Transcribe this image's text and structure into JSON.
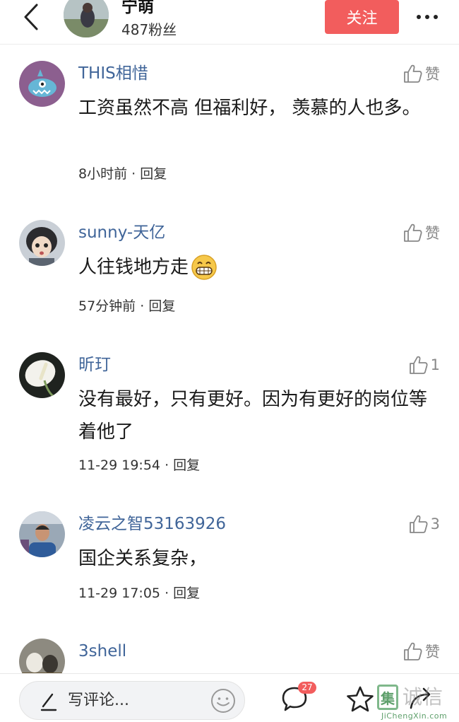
{
  "header": {
    "author_name": "宁萌",
    "fans": "487粉丝",
    "follow_label": "关注"
  },
  "comments": [
    {
      "name": "THIS相惜",
      "like": "赞",
      "text": "工资虽然不高 但福利好， 羡慕的人也多。",
      "time": "8小时前",
      "reply": "回复",
      "avatar": "blue-monster-avatar"
    },
    {
      "name": "sunny-天亿",
      "like": "赞",
      "text": "人往钱地方走",
      "emoji": "grinning-emoji",
      "time": "57分钟前",
      "reply": "回复",
      "avatar": "anime-boy-avatar"
    },
    {
      "name": "昕玎",
      "like": "1",
      "text": "没有最好，只有更好。因为有更好的岗位等着他了",
      "time": "11-29 19:54",
      "reply": "回复",
      "avatar": "white-flower-avatar"
    },
    {
      "name": "凌云之智53163926",
      "like": "3",
      "text": "国企关系复杂，",
      "time": "11-29 17:05",
      "reply": "回复",
      "avatar": "man-photo-avatar"
    },
    {
      "name": "3shell",
      "like": "赞",
      "text": "",
      "time": "",
      "reply": "",
      "avatar": "dog-photo-avatar"
    }
  ],
  "bottom_bar": {
    "placeholder": "写评论...",
    "comment_count": "27"
  },
  "watermark": {
    "logo_char": "集",
    "text": "诚信",
    "url": "JiChengXin.com"
  },
  "colors": {
    "name_blue": "#406599",
    "follow_red": "#f25d5d",
    "badge_red": "#f25d5d"
  }
}
